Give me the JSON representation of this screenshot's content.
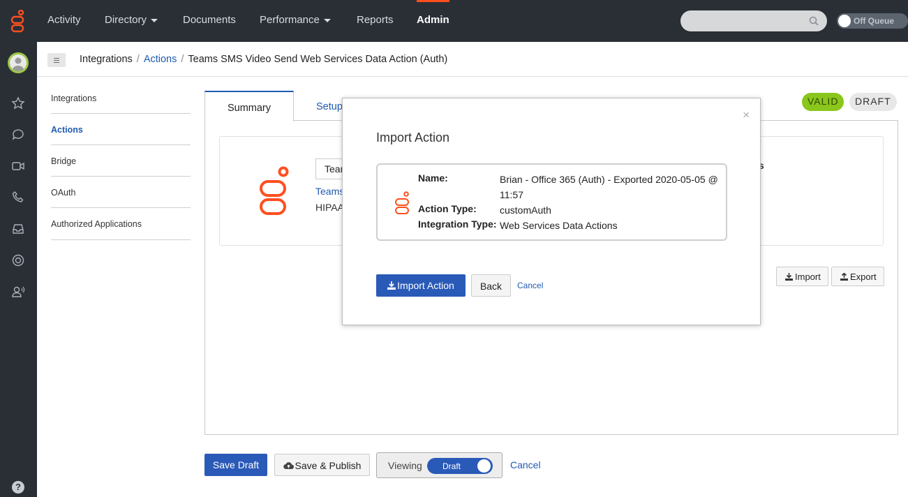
{
  "colors": {
    "brand": "#ff4f1f",
    "primary": "#2a5ab8",
    "link": "#1f5ab0",
    "valid": "#8ac61b",
    "topbar": "#2a2f36"
  },
  "topnav": {
    "items": [
      "Activity",
      "Directory",
      "Documents",
      "Performance",
      "Reports",
      "Admin"
    ],
    "active": "Admin"
  },
  "queue": {
    "label": "Off Queue"
  },
  "breadcrumb": {
    "root": "Integrations",
    "section": "Actions",
    "current": "Teams SMS Video Send Web Services Data Action (Auth)"
  },
  "sidenav": {
    "items": [
      "Integrations",
      "Actions",
      "Bridge",
      "OAuth",
      "Authorized Applications"
    ],
    "active": "Actions"
  },
  "tabs": [
    "Summary",
    "Setup"
  ],
  "status": {
    "valid": "VALID",
    "draft": "DRAFT"
  },
  "card": {
    "name_value": "Teams SMS Video Send Web Services Data Action (Auth)",
    "link": "Teams",
    "note": "HIPAA",
    "tail": "s"
  },
  "actions": {
    "import": "Import",
    "export": "Export"
  },
  "bottom": {
    "save_draft": "Save Draft",
    "save_publish": "Save & Publish",
    "viewing": "Viewing",
    "draft_toggle": "Draft",
    "cancel": "Cancel"
  },
  "modal": {
    "title": "Import Action",
    "close": "×",
    "fields": {
      "name_label": "Name:",
      "name_value": "Brian - Office 365 (Auth) - Exported 2020-05-05 @ 11:57",
      "action_type_label": "Action Type:",
      "action_type_value": "customAuth",
      "integration_type_label": "Integration Type:",
      "integration_type_value": "Web Services Data Actions"
    },
    "import_button": "Import Action",
    "back_button": "Back",
    "cancel": "Cancel"
  },
  "help": "?"
}
